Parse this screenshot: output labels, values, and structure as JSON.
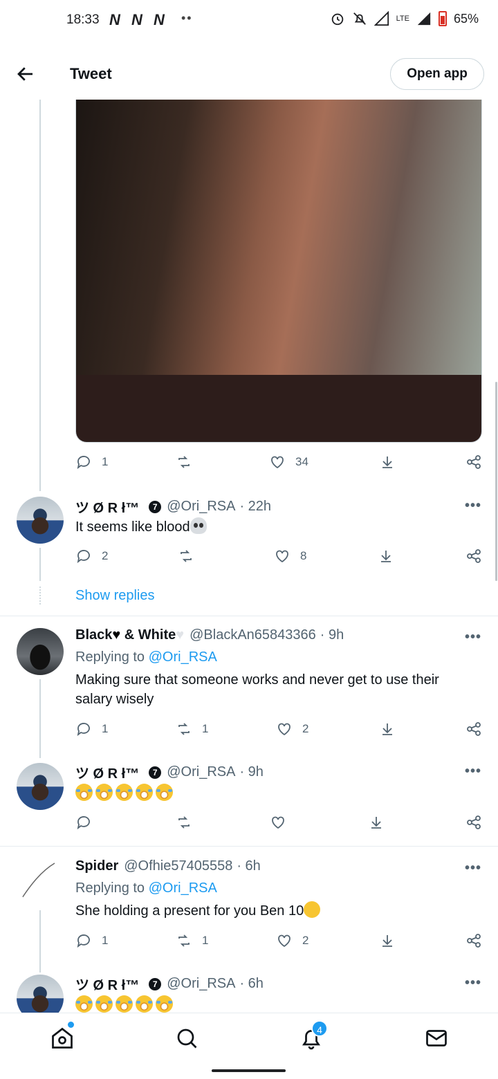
{
  "status_bar": {
    "time": "18:33",
    "n_icons": [
      "N",
      "N",
      "N"
    ],
    "dots": "••",
    "network": "LTE",
    "battery": "65%"
  },
  "header": {
    "title": "Tweet",
    "open_app": "Open app"
  },
  "media_tweet": {
    "actions": {
      "replies": "1",
      "retweets": "",
      "likes": "34"
    }
  },
  "tweets": [
    {
      "name": "ツ Ø R ł™",
      "handle": "@Ori_RSA",
      "time": "· 22h",
      "text": "It seems like blood",
      "actions": {
        "replies": "2",
        "retweets": "",
        "likes": "8"
      },
      "show_replies": "Show replies"
    },
    {
      "name_part1": "Black",
      "name_part2": " & White",
      "handle": "@BlackAn65843366",
      "time": "· 9h",
      "replying_prefix": "Replying to ",
      "replying_to": "@Ori_RSA",
      "text": "Making sure that someone works and never get to use their salary wisely",
      "actions": {
        "replies": "1",
        "retweets": "1",
        "likes": "2"
      }
    },
    {
      "name": "ツ Ø R ł™",
      "handle": "@Ori_RSA",
      "time": "· 9h",
      "actions": {
        "replies": "",
        "retweets": "",
        "likes": ""
      }
    },
    {
      "name": "Spider",
      "handle": "@Ofhie57405558",
      "time": "· 6h",
      "replying_prefix": "Replying to ",
      "replying_to": "@Ori_RSA",
      "text": "She holding a present for you Ben 10",
      "actions": {
        "replies": "1",
        "retweets": "1",
        "likes": "2"
      }
    },
    {
      "name": "ツ Ø R ł™",
      "handle": "@Ori_RSA",
      "time": "· 6h"
    }
  ],
  "more": "•••",
  "verified_badge": "7",
  "bottom_nav": {
    "notifications_badge": "4"
  },
  "icons": [
    "back-arrow-icon",
    "reply-icon",
    "retweet-icon",
    "like-icon",
    "download-icon",
    "share-icon",
    "more-icon",
    "home-icon",
    "search-icon",
    "notifications-icon",
    "messages-icon"
  ],
  "colors": {
    "accent": "#1d9bf0",
    "text": "#0f1419",
    "secondary": "#536471"
  }
}
